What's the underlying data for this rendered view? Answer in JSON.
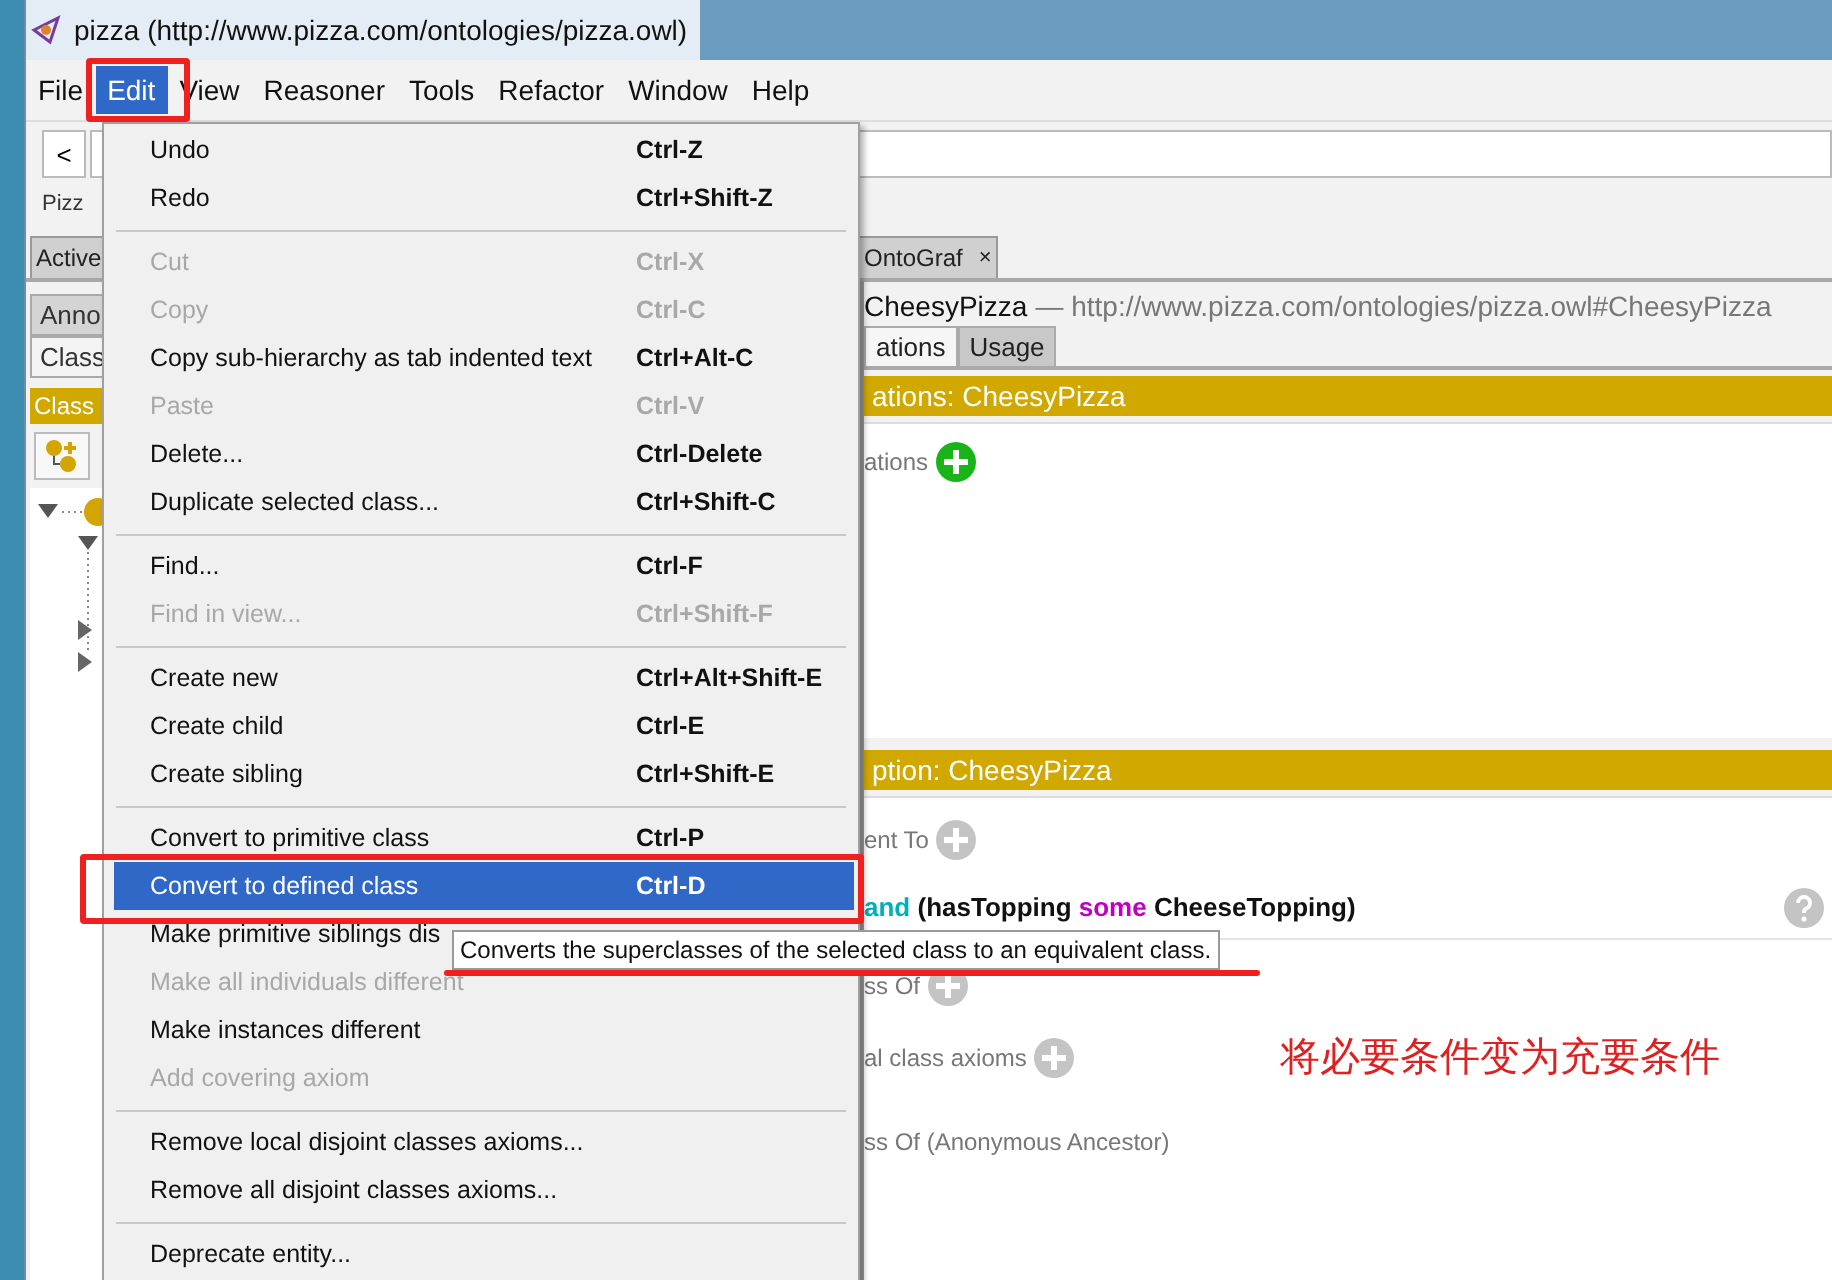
{
  "window": {
    "title": "pizza (http://www.pizza.com/ontologies/pizza.owl)"
  },
  "menu_bar": [
    {
      "label": "File",
      "selected": false
    },
    {
      "label": "Edit",
      "selected": true
    },
    {
      "label": "View",
      "selected": false
    },
    {
      "label": "Reasoner",
      "selected": false
    },
    {
      "label": "Tools",
      "selected": false
    },
    {
      "label": "Refactor",
      "selected": false
    },
    {
      "label": "Window",
      "selected": false
    },
    {
      "label": "Help",
      "selected": false
    }
  ],
  "navigation": {
    "back_button": "<",
    "breadcrumb": "Pizz"
  },
  "workspace_tabs": [
    {
      "label": "Active",
      "selected": false
    },
    {
      "label": "OntoGraf",
      "selected": false,
      "close": "×"
    }
  ],
  "left_panel": {
    "tabs": [
      {
        "label": "Anno",
        "selected": false
      },
      {
        "label": "Class",
        "selected": true
      }
    ],
    "header": "Class"
  },
  "right_panel": {
    "entity": "CheesyPizza",
    "iri": "— http://www.pizza.com/ontologies/pizza.owl#CheesyPizza",
    "tabs": [
      {
        "label": "ations",
        "selected": true
      },
      {
        "label": "Usage",
        "selected": false
      }
    ],
    "annotations_header": "ations: CheesyPizza",
    "annotations_label": "ations",
    "description_header": "ption: CheesyPizza",
    "sections": [
      {
        "label": "ent To",
        "add": true,
        "expression": [
          {
            "kind": "keyword",
            "text": "and"
          },
          {
            "kind": "plain",
            "text": "(hasTopping"
          },
          {
            "kind": "quantifier",
            "text": "some"
          },
          {
            "kind": "plain",
            "text": "CheeseTopping)"
          }
        ]
      },
      {
        "label": "ss Of",
        "add": true
      },
      {
        "label": "al class axioms",
        "add": true
      },
      {
        "label": "ss Of (Anonymous Ancestor)",
        "add": false
      }
    ]
  },
  "annotation_note": "将必要条件变为充要条件",
  "edit_menu": {
    "items": [
      {
        "kind": "item",
        "label": "Undo",
        "shortcut": "Ctrl-Z",
        "disabled": false,
        "selected": false
      },
      {
        "kind": "item",
        "label": "Redo",
        "shortcut": "Ctrl+Shift-Z",
        "disabled": false,
        "selected": false
      },
      {
        "kind": "separator"
      },
      {
        "kind": "item",
        "label": "Cut",
        "shortcut": "Ctrl-X",
        "disabled": true,
        "selected": false
      },
      {
        "kind": "item",
        "label": "Copy",
        "shortcut": "Ctrl-C",
        "disabled": true,
        "selected": false
      },
      {
        "kind": "item",
        "label": "Copy sub-hierarchy as tab indented text",
        "shortcut": "Ctrl+Alt-C",
        "disabled": false,
        "selected": false
      },
      {
        "kind": "item",
        "label": "Paste",
        "shortcut": "Ctrl-V",
        "disabled": true,
        "selected": false
      },
      {
        "kind": "item",
        "label": "Delete...",
        "shortcut": "Ctrl-Delete",
        "disabled": false,
        "selected": false
      },
      {
        "kind": "item",
        "label": "Duplicate selected class...",
        "shortcut": "Ctrl+Shift-C",
        "disabled": false,
        "selected": false
      },
      {
        "kind": "separator"
      },
      {
        "kind": "item",
        "label": "Find...",
        "shortcut": "Ctrl-F",
        "disabled": false,
        "selected": false
      },
      {
        "kind": "item",
        "label": "Find in view...",
        "shortcut": "Ctrl+Shift-F",
        "disabled": true,
        "selected": false
      },
      {
        "kind": "separator"
      },
      {
        "kind": "item",
        "label": "Create new",
        "shortcut": "Ctrl+Alt+Shift-E",
        "disabled": false,
        "selected": false
      },
      {
        "kind": "item",
        "label": "Create child",
        "shortcut": "Ctrl-E",
        "disabled": false,
        "selected": false
      },
      {
        "kind": "item",
        "label": "Create sibling",
        "shortcut": "Ctrl+Shift-E",
        "disabled": false,
        "selected": false
      },
      {
        "kind": "separator"
      },
      {
        "kind": "item",
        "label": "Convert to primitive class",
        "shortcut": "Ctrl-P",
        "disabled": false,
        "selected": false
      },
      {
        "kind": "item",
        "label": "Convert to defined class",
        "shortcut": "Ctrl-D",
        "disabled": false,
        "selected": true
      },
      {
        "kind": "item",
        "label": "Make primitive siblings dis",
        "disabled": false,
        "selected": false
      },
      {
        "kind": "item",
        "label": "Make all individuals different",
        "disabled": true,
        "selected": false
      },
      {
        "kind": "item",
        "label": "Make instances different",
        "disabled": false,
        "selected": false
      },
      {
        "kind": "item",
        "label": "Add covering axiom",
        "disabled": true,
        "selected": false
      },
      {
        "kind": "separator"
      },
      {
        "kind": "item",
        "label": "Remove local disjoint classes axioms...",
        "disabled": false,
        "selected": false
      },
      {
        "kind": "item",
        "label": "Remove all disjoint classes axioms...",
        "disabled": false,
        "selected": false
      },
      {
        "kind": "separator"
      },
      {
        "kind": "item",
        "label": "Deprecate entity...",
        "disabled": false,
        "selected": false
      }
    ]
  },
  "tooltip": "Converts the superclasses of the selected class to an equivalent class."
}
